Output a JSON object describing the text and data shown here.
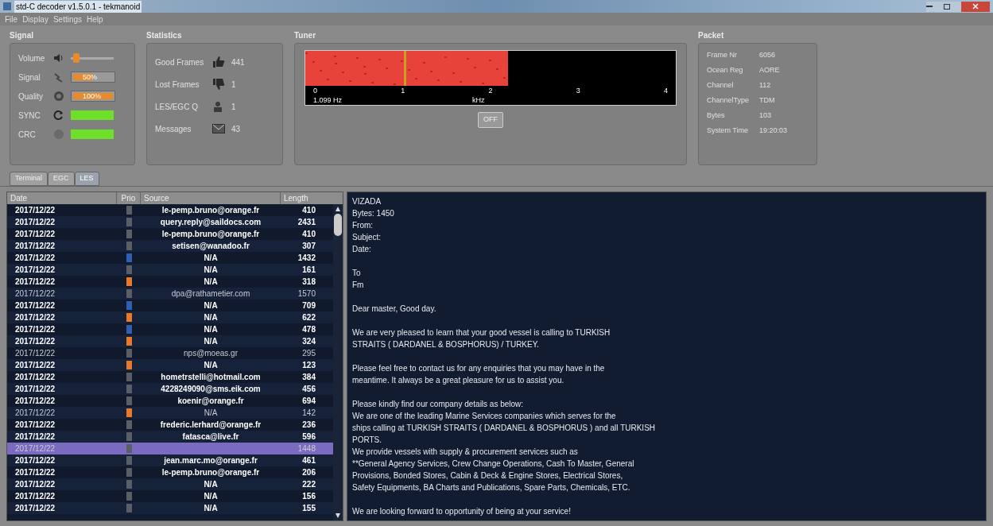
{
  "window": {
    "title": "std-C decoder v1.5.0.1 - tekmanoid"
  },
  "menu": [
    "File",
    "Display",
    "Settings",
    "Help"
  ],
  "signal": {
    "title": "Signal",
    "rows": [
      {
        "kind": "slider",
        "label": "Volume",
        "level": 0.06
      },
      {
        "kind": "bar",
        "label": "Signal",
        "level": 0.5,
        "reading": "50%"
      },
      {
        "kind": "bar",
        "label": "Quality",
        "level": 1,
        "reading": "100%"
      },
      {
        "kind": "status",
        "label": "SYNC",
        "on": true
      },
      {
        "kind": "status",
        "label": "CRC",
        "on": true
      }
    ]
  },
  "statistics": {
    "title": "Statistics",
    "rows": [
      {
        "kind": "good",
        "label": "Good Frames",
        "value": "441"
      },
      {
        "kind": "lost",
        "label": "Lost Frames",
        "value": "1"
      },
      {
        "kind": "queue",
        "label": "LES/EGC Q",
        "value": "1"
      },
      {
        "kind": "messages",
        "label": "Messages",
        "value": "43"
      }
    ]
  },
  "tuner": {
    "title": "Tuner",
    "ticks": [
      "0",
      "1",
      "2",
      "3",
      "4"
    ],
    "frequency": "1.099 Hz",
    "unit": "kHz",
    "button": "OFF"
  },
  "packet": {
    "title": "Packet",
    "fields": [
      {
        "label": "Frame Nr",
        "value": "6056"
      },
      {
        "label": "Ocean Reg",
        "value": "AORE"
      },
      {
        "label": "Channel",
        "value": "112"
      },
      {
        "label": "ChannelType",
        "value": "TDM"
      },
      {
        "label": "Bytes",
        "value": "103"
      },
      {
        "label": "System Time",
        "value": "19:20:03"
      }
    ]
  },
  "tabs": [
    {
      "label": "Terminal",
      "selected": false
    },
    {
      "label": "EGC",
      "selected": false
    },
    {
      "label": "LES",
      "selected": true
    }
  ],
  "table": {
    "columns": [
      "Date",
      "Prio",
      "Source",
      "Length"
    ],
    "rows": [
      {
        "date": "2017/12/22",
        "color": "#5a5f66",
        "source": "le-pemp.bruno@orange.fr",
        "length": "410",
        "unread": true,
        "selected": false
      },
      {
        "date": "2017/12/22",
        "color": "#5a5f66",
        "source": "query.reply@saildocs.com",
        "length": "2431",
        "unread": true,
        "selected": false
      },
      {
        "date": "2017/12/22",
        "color": "#5a5f66",
        "source": "le-pemp.bruno@orange.fr",
        "length": "410",
        "unread": true,
        "selected": false
      },
      {
        "date": "2017/12/22",
        "color": "#5a5f66",
        "source": "setisen@wanadoo.fr",
        "length": "307",
        "unread": true,
        "selected": false
      },
      {
        "date": "2017/12/22",
        "color": "#2f5fb0",
        "source": "N/A",
        "length": "1432",
        "unread": true,
        "selected": false
      },
      {
        "date": "2017/12/22",
        "color": "#5a5f66",
        "source": "N/A",
        "length": "161",
        "unread": true,
        "selected": false
      },
      {
        "date": "2017/12/22",
        "color": "#e8782a",
        "source": "N/A",
        "length": "318",
        "unread": true,
        "selected": false
      },
      {
        "date": "2017/12/22",
        "color": "#5a5f66",
        "source": "dpa@rathametier.com",
        "length": "1570",
        "unread": false,
        "selected": false
      },
      {
        "date": "2017/12/22",
        "color": "#2f5fb0",
        "source": "N/A",
        "length": "709",
        "unread": true,
        "selected": false
      },
      {
        "date": "2017/12/22",
        "color": "#e8782a",
        "source": "N/A",
        "length": "622",
        "unread": true,
        "selected": false
      },
      {
        "date": "2017/12/22",
        "color": "#2f5fb0",
        "source": "N/A",
        "length": "478",
        "unread": true,
        "selected": false
      },
      {
        "date": "2017/12/22",
        "color": "#e8782a",
        "source": "N/A",
        "length": "324",
        "unread": true,
        "selected": false
      },
      {
        "date": "2017/12/22",
        "color": "#5a5f66",
        "source": "nps@moeas.gr",
        "length": "295",
        "unread": false,
        "selected": false
      },
      {
        "date": "2017/12/22",
        "color": "#e8782a",
        "source": "N/A",
        "length": "123",
        "unread": true,
        "selected": false
      },
      {
        "date": "2017/12/22",
        "color": "#5a5f66",
        "source": "hometrstelli@hotmail.com",
        "length": "384",
        "unread": true,
        "selected": false
      },
      {
        "date": "2017/12/22",
        "color": "#5a5f66",
        "source": "4228249090@sms.eik.com",
        "length": "456",
        "unread": true,
        "selected": false
      },
      {
        "date": "2017/12/22",
        "color": "#5a5f66",
        "source": "koenir@orange.fr",
        "length": "694",
        "unread": true,
        "selected": false
      },
      {
        "date": "2017/12/22",
        "color": "#e8782a",
        "source": "N/A",
        "length": "142",
        "unread": false,
        "selected": false
      },
      {
        "date": "2017/12/22",
        "color": "#5a5f66",
        "source": "frederic.lerhard@orange.fr",
        "length": "236",
        "unread": true,
        "selected": false
      },
      {
        "date": "2017/12/22",
        "color": "#5a5f66",
        "source": "fatasca@live.fr",
        "length": "596",
        "unread": true,
        "selected": false
      },
      {
        "date": "2017/12/22",
        "color": "#5a5f66",
        "length": "1448",
        "unread": false,
        "selected": true
      },
      {
        "date": "2017/12/22",
        "color": "#5a5f66",
        "source": "jean.marc.mo@orange.fr",
        "length": "461",
        "unread": true,
        "selected": false
      },
      {
        "date": "2017/12/22",
        "color": "#5a5f66",
        "source": "le-pemp.bruno@orange.fr",
        "length": "206",
        "unread": true,
        "selected": false
      },
      {
        "date": "2017/12/22",
        "color": "#5a5f66",
        "source": "N/A",
        "length": "222",
        "unread": true,
        "selected": false
      },
      {
        "date": "2017/12/22",
        "color": "#5a5f66",
        "source": "N/A",
        "length": "156",
        "unread": true,
        "selected": false
      },
      {
        "date": "2017/12/22",
        "color": "#5a5f66",
        "source": "N/A",
        "length": "155",
        "unread": true,
        "selected": false
      }
    ]
  },
  "message": {
    "paragraphs": [
      [
        "VIZADA",
        "Bytes: 1450",
        "From:",
        "Subject:",
        "Date:"
      ],
      [
        "To",
        "Fm"
      ],
      [
        "Dear master, Good day."
      ],
      [
        "We are very pleased to learn that your good vessel is calling to TURKISH",
        "STRAITS ( DARDANEL & BOSPHORUS) / TURKEY."
      ],
      [
        "Please feel free to contact us for any enquiries that you may have in the",
        "meantime. It always be a great pleasure for us to assist you."
      ],
      [
        "Please kindly find our company details as below:",
        "We are one of the leading Marine Services companies which serves for the",
        "ships calling at TURKISH STRAITS ( DARDANEL & BOSPHORUS ) and all TURKISH",
        "PORTS.",
        "We provide vessels with supply & procurement services such as",
        "**General Agency Services, Crew Change Operations, Cash To Master, General",
        "Provisions, Bonded Stores, Cabin & Deck & Engine Stores, Electrical Stores,",
        "Safety Equipments, BA Charts and Publications, Spare Parts, Chemicals, ETC."
      ],
      [
        "We are looking forward to opportunity of being at your service!"
      ]
    ]
  }
}
